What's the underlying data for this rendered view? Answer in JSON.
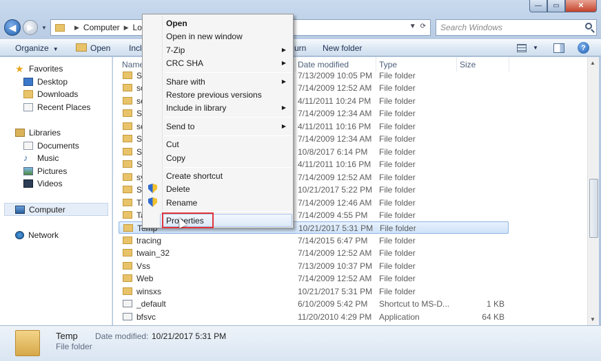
{
  "window": {
    "caption": {
      "minimize": "—",
      "maximize": "▭",
      "close": "✕"
    }
  },
  "address": {
    "crumbs": [
      "Computer",
      "Loc"
    ],
    "search_placeholder": "Search Windows"
  },
  "toolbar": {
    "organize": "Organize",
    "open": "Open",
    "include": "Incl",
    "burn": "urn",
    "new_folder": "New folder"
  },
  "nav": {
    "favorites": "Favorites",
    "desktop": "Desktop",
    "downloads": "Downloads",
    "recent": "Recent Places",
    "libraries": "Libraries",
    "documents": "Documents",
    "music": "Music",
    "pictures": "Pictures",
    "videos": "Videos",
    "computer": "Computer",
    "network": "Network"
  },
  "columns": {
    "name": "Name",
    "date": "Date modified",
    "type": "Type",
    "size": "Size"
  },
  "files": [
    {
      "name": "So",
      "date": "7/13/2009 10:05 PM",
      "type": "File folder",
      "size": ""
    },
    {
      "name": "sc",
      "date": "7/14/2009 12:52 AM",
      "type": "File folder",
      "size": ""
    },
    {
      "name": "se",
      "date": "4/11/2011 10:24 PM",
      "type": "File folder",
      "size": ""
    },
    {
      "name": "Se",
      "date": "7/14/2009 12:34 AM",
      "type": "File folder",
      "size": ""
    },
    {
      "name": "se",
      "date": "4/11/2011 10:16 PM",
      "type": "File folder",
      "size": ""
    },
    {
      "name": "Se",
      "date": "7/14/2009 12:34 AM",
      "type": "File folder",
      "size": ""
    },
    {
      "name": "Sc",
      "date": "10/8/2017 6:14 PM",
      "type": "File folder",
      "size": ""
    },
    {
      "name": "Sp",
      "date": "4/11/2011 10:16 PM",
      "type": "File folder",
      "size": ""
    },
    {
      "name": "sy",
      "date": "7/14/2009 12:52 AM",
      "type": "File folder",
      "size": ""
    },
    {
      "name": "Sy",
      "date": "10/21/2017 5:22 PM",
      "type": "File folder",
      "size": ""
    },
    {
      "name": "TA",
      "date": "7/14/2009 12:46 AM",
      "type": "File folder",
      "size": ""
    },
    {
      "name": "Ta",
      "date": "7/14/2009 4:55 PM",
      "type": "File folder",
      "size": ""
    },
    {
      "name": "Temp",
      "date": "10/21/2017 5:31 PM",
      "type": "File folder",
      "size": ""
    },
    {
      "name": "tracing",
      "date": "7/14/2015 6:47 PM",
      "type": "File folder",
      "size": ""
    },
    {
      "name": "twain_32",
      "date": "7/14/2009 12:52 AM",
      "type": "File folder",
      "size": ""
    },
    {
      "name": "Vss",
      "date": "7/13/2009 10:37 PM",
      "type": "File folder",
      "size": ""
    },
    {
      "name": "Web",
      "date": "7/14/2009 12:52 AM",
      "type": "File folder",
      "size": ""
    },
    {
      "name": "winsxs",
      "date": "10/21/2017 5:31 PM",
      "type": "File folder",
      "size": ""
    },
    {
      "name": "_default",
      "date": "6/10/2009 5:42 PM",
      "type": "Shortcut to MS-D...",
      "size": "1 KB"
    },
    {
      "name": "bfsvc",
      "date": "11/20/2010 4:29 PM",
      "type": "Application",
      "size": "64 KB"
    }
  ],
  "context_menu": {
    "open": "Open",
    "open_new_window": "Open in new window",
    "zip": "7-Zip",
    "crc": "CRC SHA",
    "share_with": "Share with",
    "restore": "Restore previous versions",
    "include_library": "Include in library",
    "send_to": "Send to",
    "cut": "Cut",
    "copy": "Copy",
    "create_shortcut": "Create shortcut",
    "delete": "Delete",
    "rename": "Rename",
    "properties": "Properties",
    "submenu_arrow": "▶"
  },
  "details": {
    "name": "Temp",
    "date_label": "Date modified:",
    "date": "10/21/2017 5:31 PM",
    "type": "File folder"
  },
  "colors": {
    "selection_border": "#8fb4e3",
    "highlight_box": "#e0343a"
  }
}
